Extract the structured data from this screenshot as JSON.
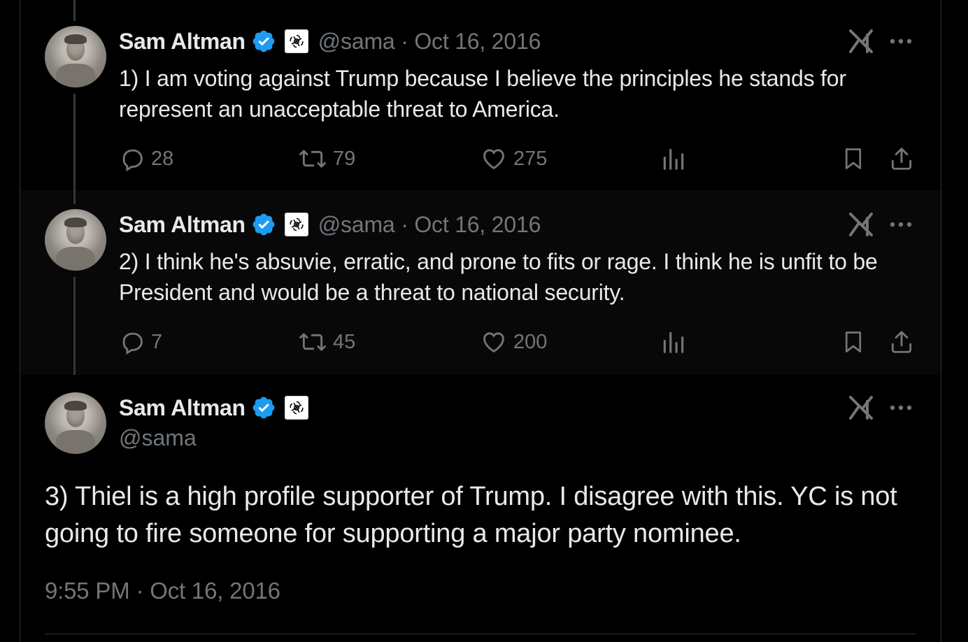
{
  "tweets": [
    {
      "author": "Sam Altman",
      "handle": "@sama",
      "meta": "@sama · Oct 16, 2016",
      "text": "1) I am voting against Trump because I believe the principles he stands for represent an unacceptable threat to America.",
      "replies": "28",
      "reposts": "79",
      "likes": "275"
    },
    {
      "author": "Sam Altman",
      "handle": "@sama",
      "meta": "@sama · Oct 16, 2016",
      "text": "2) I think he's absuvie, erratic, and prone to fits or rage. I think he is unfit to be President and would be a threat to national security.",
      "replies": "7",
      "reposts": "45",
      "likes": "200"
    },
    {
      "author": "Sam Altman",
      "handle": "@sama",
      "text": "3) Thiel is a high profile supporter of Trump. I disagree with this. YC is not going to fire someone for supporting a major party nominee.",
      "timestamp": "9:55 PM · Oct 16, 2016"
    }
  ],
  "icons": {
    "verified": "verified-badge-icon",
    "org": "openai-logo-icon",
    "grok": "grok-icon",
    "more": "more-icon",
    "reply": "reply-icon",
    "repost": "repost-icon",
    "like": "like-icon",
    "views": "views-icon",
    "bookmark": "bookmark-icon",
    "share": "share-icon"
  },
  "colors": {
    "background": "#000000",
    "text": "#e7e9ea",
    "secondary": "#71767b",
    "verified": "#1d9bf0"
  }
}
